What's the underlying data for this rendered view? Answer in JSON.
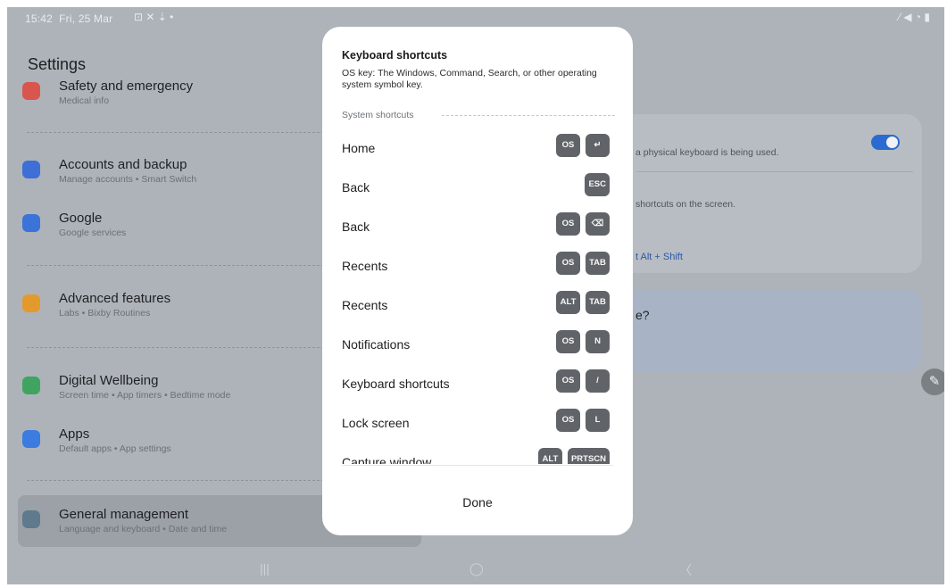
{
  "status_bar": {
    "time": "15:42",
    "date": "Fri, 25 Mar",
    "left_icons": "⊡ ✕ ⇣ •",
    "right_icons": "⁄ ◀ ◔ ▮"
  },
  "settings": {
    "title": "Settings",
    "items": [
      {
        "title": "Safety and emergency",
        "subtitle": "Medical info",
        "icon": "safety-icon",
        "color": "#d9564f"
      },
      {
        "title": "Accounts and backup",
        "subtitle": "Manage accounts  •  Smart Switch",
        "icon": "sync-icon",
        "color": "#3d6fd6"
      },
      {
        "title": "Google",
        "subtitle": "Google services",
        "icon": "google-icon",
        "color": "#3b73d8"
      },
      {
        "title": "Advanced features",
        "subtitle": "Labs  •  Bixby Routines",
        "icon": "gear-plus-icon",
        "color": "#e39a2d"
      },
      {
        "title": "Digital Wellbeing",
        "subtitle": "Screen time  •  App timers  •  Bedtime mode",
        "icon": "wellbeing-icon",
        "color": "#3fa460"
      },
      {
        "title": "Apps",
        "subtitle": "Default apps  •  App settings",
        "icon": "apps-icon",
        "color": "#3c7be0"
      },
      {
        "title": "General management",
        "subtitle": "Language and keyboard  •  Date and time",
        "icon": "sliders-icon",
        "color": "#5e7a8c"
      }
    ]
  },
  "right_panel": {
    "text1": "a physical keyboard is being used.",
    "text2": "shortcuts on the screen.",
    "text3": "t Alt + Shift",
    "text4": "e?",
    "toggle_on": true
  },
  "dialog": {
    "title": "Keyboard shortcuts",
    "description": "OS key: The Windows, Command, Search, or other operating system symbol key.",
    "section": "System shortcuts",
    "shortcuts": [
      {
        "label": "Home",
        "keys": [
          "OS",
          "↵"
        ]
      },
      {
        "label": "Back",
        "keys": [
          "ESC"
        ]
      },
      {
        "label": "Back",
        "keys": [
          "OS",
          "⌫"
        ]
      },
      {
        "label": "Recents",
        "keys": [
          "OS",
          "TAB"
        ]
      },
      {
        "label": "Recents",
        "keys": [
          "ALT",
          "TAB"
        ]
      },
      {
        "label": "Notifications",
        "keys": [
          "OS",
          "N"
        ]
      },
      {
        "label": "Keyboard shortcuts",
        "keys": [
          "OS",
          "/"
        ]
      },
      {
        "label": "Lock screen",
        "keys": [
          "OS",
          "L"
        ]
      },
      {
        "label": "Capture window",
        "keys": [
          "ALT",
          "PRTSCN"
        ]
      }
    ],
    "done_label": "Done"
  },
  "nav_bar": {
    "recents": "|||",
    "home": "◯",
    "back": "〈"
  },
  "edit_icon_glyph": "✎"
}
